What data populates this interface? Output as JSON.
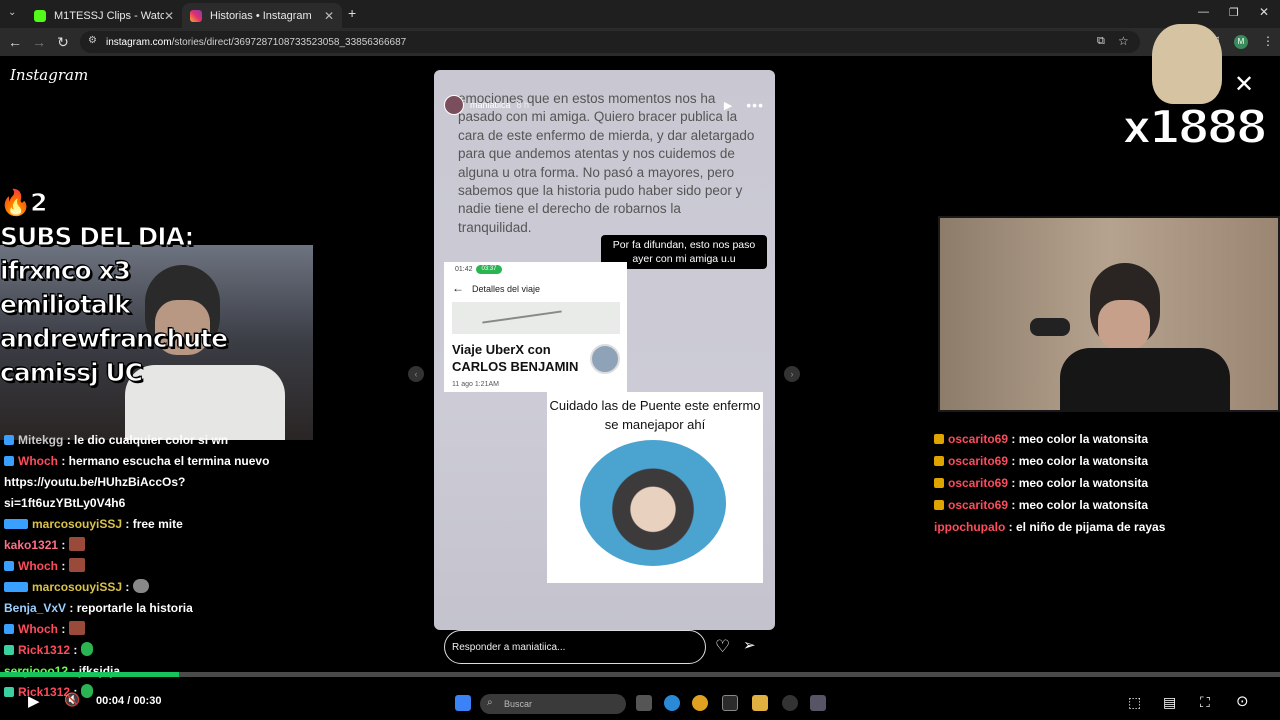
{
  "browser": {
    "tabs": [
      {
        "label": "M1TESSJ Clips - Watch Live on",
        "active": false
      },
      {
        "label": "Historias • Instagram",
        "active": true
      }
    ],
    "url_domain": "instagram.com",
    "url_path": "/stories/direct/3697287108733523058_33856366687"
  },
  "instagram": {
    "logo": "Instagram",
    "story": {
      "username": "maniatiica",
      "time": "8 h",
      "text": "emociones que en estos momentos nos ha pasado con mi amiga. Quiero bracer publica la cara de este enfermo de mierda, y dar aletargado para que andemos atentas y nos cuidemos de alguna u otra forma. No pasó a mayores, pero sabemos que la historia pudo haber sido peor y nadie tiene el derecho de robarnos la tranquilidad.",
      "caption": "Por fa difundan, esto nos paso ayer con mi amiga u.u",
      "uber": {
        "status_time": "01:42",
        "status_badge": "03:37",
        "header": "Detalles del viaje",
        "title": "Viaje UberX con CARLOS BENJAMIN",
        "date": "11 ago 1:21AM"
      },
      "warning": "Cuidado las  de Puente este enfermo se manejapor ahí"
    },
    "reply_placeholder": "Responder a maniatiica..."
  },
  "overlay": {
    "subs_count": "2",
    "subs_lines": [
      "SUBS DEL DIA:",
      "ifrxnco x3",
      "emiliotalk",
      "andrewfranchute",
      "camissj UC"
    ],
    "meme_text": "x1888"
  },
  "chat_left": [
    {
      "user": "Mitekgg",
      "color": "#c8c8c8",
      "msg": ": le dio cualquier color si wn"
    },
    {
      "user": "Whoch",
      "color": "#ff4b5c",
      "msg": ": hermano escucha el termina nuevo"
    },
    {
      "user": "",
      "color": "#fff",
      "msg": "https://youtu.be/HUhzBiAccOs?"
    },
    {
      "user": "",
      "color": "#fff",
      "msg": "si=1ft6uzYBtLy0V4h6"
    },
    {
      "user": "marcosouyiSSJ",
      "color": "#d9c24a",
      "msg": ": free mite"
    },
    {
      "user": "kako1321",
      "color": "#ff6f88",
      "msg": ":"
    },
    {
      "user": "Whoch",
      "color": "#ff4b5c",
      "msg": ":"
    },
    {
      "user": "marcosouyiSSJ",
      "color": "#d9c24a",
      "msg": ":"
    },
    {
      "user": "Benja_VxV",
      "color": "#9ad0ff",
      "msg": ": reportarle la historia"
    },
    {
      "user": "Whoch",
      "color": "#ff4b5c",
      "msg": ":"
    },
    {
      "user": "Rick1312",
      "color": "#ff4b5c",
      "msg": ":"
    },
    {
      "user": "sergiooo12",
      "color": "#6bff4b",
      "msg": ": jfksjdja"
    },
    {
      "user": "Rick1312",
      "color": "#ff4b5c",
      "msg": ":"
    }
  ],
  "chat_right": [
    {
      "user": "oscarito69",
      "msg": ": meo color la watonsita"
    },
    {
      "user": "oscarito69",
      "msg": ": meo color la watonsita"
    },
    {
      "user": "oscarito69",
      "msg": ": meo color la watonsita"
    },
    {
      "user": "oscarito69",
      "msg": ": meo color la watonsita"
    },
    {
      "user": "ippochupalo",
      "msg": ": el niño de pijama de rayas"
    }
  ],
  "player": {
    "current": "00:04",
    "total": "00:30",
    "progress": 0.14
  },
  "taskbar": {
    "search": "Buscar"
  },
  "colors": {
    "accent_green": "#16c35c",
    "chat_red": "#ff4b5c"
  }
}
